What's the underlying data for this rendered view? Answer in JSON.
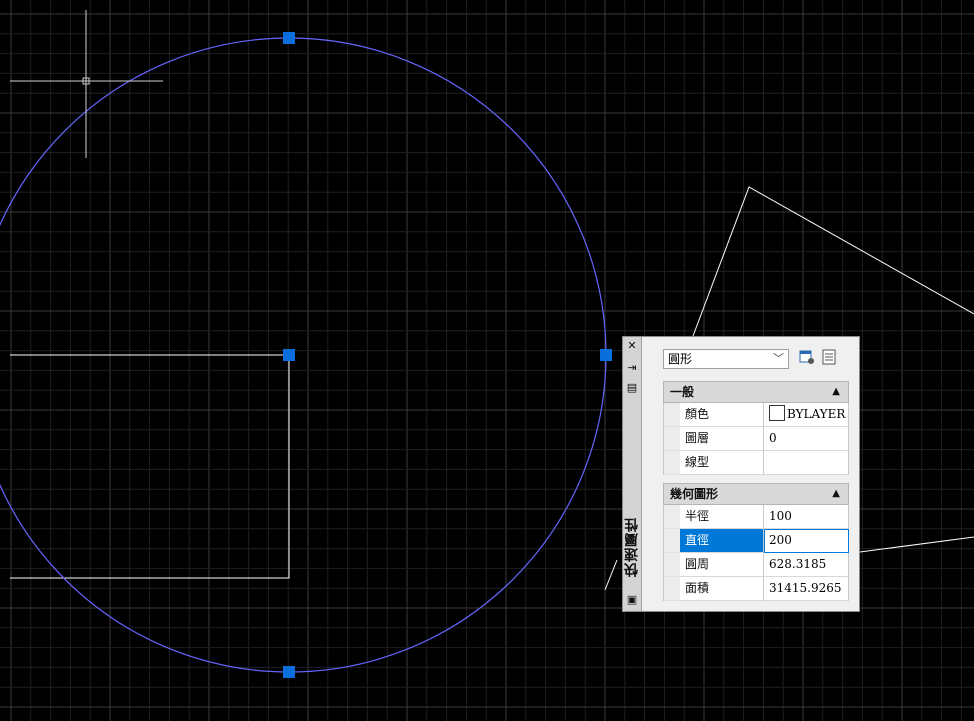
{
  "colors": {
    "background": "#000000",
    "grid_minor": "#1f1f1f",
    "grid_major": "#3a3a3a",
    "circle": "#6666ff",
    "geometry": "#ffffff",
    "grip": "#0a6fdc",
    "selected_row": "#0078d7"
  },
  "quick_properties": {
    "side_title": "快速屬性",
    "object_type": "圓形",
    "sections": {
      "general": {
        "label": "一般",
        "rows": [
          {
            "name": "顏色",
            "value": "BYLAYER"
          },
          {
            "name": "圖層",
            "value": "0"
          },
          {
            "name": "線型",
            "value": ""
          }
        ]
      },
      "geometry": {
        "label": "幾何圖形",
        "rows": [
          {
            "name": "半徑",
            "value": "100"
          },
          {
            "name": "直徑",
            "value": "200"
          },
          {
            "name": "圓周",
            "value": "628.3185"
          },
          {
            "name": "面積",
            "value": "31415.9265"
          }
        ]
      }
    },
    "icons": [
      "close-icon",
      "pin-icon",
      "menu-icon",
      "quick-select-icon",
      "toggle-pickadd-icon",
      "customize-icon"
    ]
  }
}
